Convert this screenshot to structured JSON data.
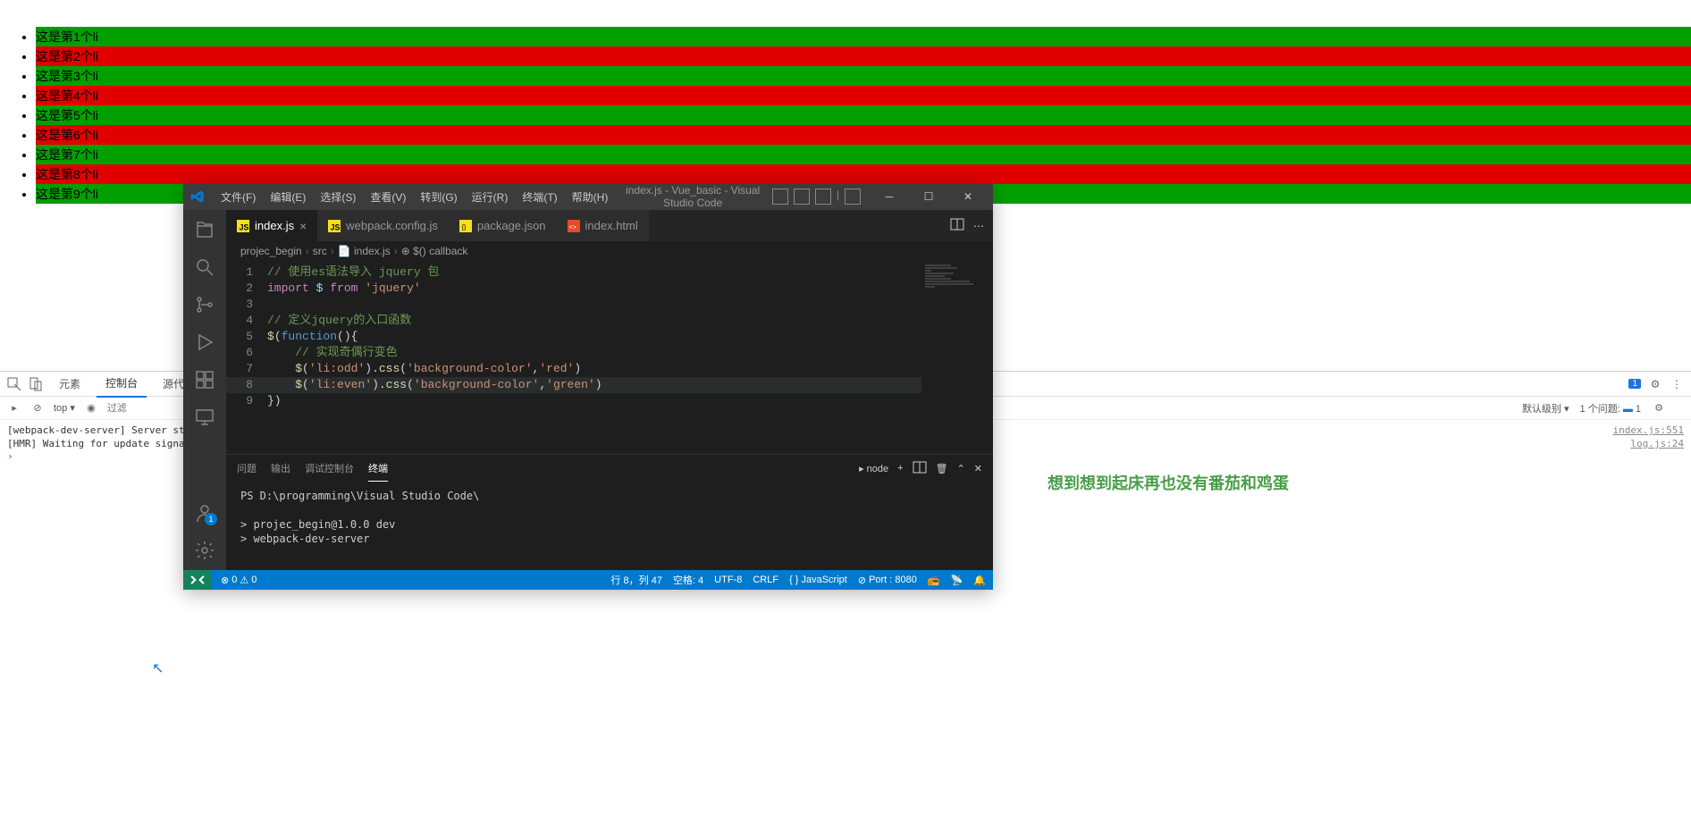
{
  "page": {
    "list_items": [
      "这是第1个li",
      "这是第2个li",
      "这是第3个li",
      "这是第4个li",
      "这是第5个li",
      "这是第6个li",
      "这是第7个li",
      "这是第8个li",
      "这是第9个li"
    ]
  },
  "devtools": {
    "tabs": {
      "elements": "元素",
      "console": "控制台",
      "sources": "源代码"
    },
    "toolbar": {
      "top": "top",
      "filter_placeholder": "过滤",
      "level": "默认级别",
      "issues_label": "1 个问题:",
      "issues_count": "1"
    },
    "console": [
      {
        "text": "[webpack-dev-server] Server started",
        "src": "index.js:551"
      },
      {
        "text": "[HMR] Waiting for update signal fr",
        "src": "log.js:24"
      }
    ],
    "errors_count": "1"
  },
  "vscode": {
    "menu": [
      "文件(F)",
      "编辑(E)",
      "选择(S)",
      "查看(V)",
      "转到(G)",
      "运行(R)",
      "终端(T)",
      "帮助(H)"
    ],
    "title": "index.js - Vue_basic - Visual Studio Code",
    "tabs": [
      {
        "icon": "js-icon",
        "label": "index.js",
        "active": true
      },
      {
        "icon": "js-icon",
        "label": "webpack.config.js",
        "active": false
      },
      {
        "icon": "json-icon",
        "label": "package.json",
        "active": false
      },
      {
        "icon": "html-icon",
        "label": "index.html",
        "active": false
      }
    ],
    "breadcrumb": [
      "projec_begin",
      "src",
      "index.js",
      "$() callback"
    ],
    "code_lines": [
      {
        "n": 1,
        "html": "<span class='tk-comment'>// 使用es语法导入 jquery 包</span>"
      },
      {
        "n": 2,
        "html": "<span class='tk-keyword'>import</span> <span class='tk-var'>$</span> <span class='tk-keyword'>from</span> <span class='tk-string'>'jquery'</span>"
      },
      {
        "n": 3,
        "html": ""
      },
      {
        "n": 4,
        "html": "<span class='tk-comment'>// 定义jquery的入口函数</span>"
      },
      {
        "n": 5,
        "html": "<span class='tk-func'>$</span><span class='tk-punc'>(</span><span class='tk-blue'>function</span><span class='tk-punc'>(){</span>"
      },
      {
        "n": 6,
        "html": "    <span class='tk-comment'>// 实现奇偶行变色</span>"
      },
      {
        "n": 7,
        "html": "    <span class='tk-func'>$</span><span class='tk-punc'>(</span><span class='tk-string'>'li:odd'</span><span class='tk-punc'>).</span><span class='tk-func'>css</span><span class='tk-punc'>(</span><span class='tk-string'>'background-color'</span><span class='tk-punc'>,</span><span class='tk-string'>'red'</span><span class='tk-punc'>)</span>"
      },
      {
        "n": 8,
        "html": "    <span class='tk-func'>$</span><span class='tk-punc'>(</span><span class='tk-string'>'li:even'</span><span class='tk-punc'>).</span><span class='tk-func'>css</span><span class='tk-punc'>(</span><span class='tk-string'>'background-color'</span><span class='tk-punc'>,</span><span class='tk-string'>'green'</span><span class='tk-punc'>)</span>",
        "current": true
      },
      {
        "n": 9,
        "html": "<span class='tk-punc'>})</span>"
      }
    ],
    "panel": {
      "tabs": [
        "问题",
        "输出",
        "调试控制台",
        "终端"
      ],
      "active_tab": 3,
      "terminal_select": "node",
      "terminal_lines": [
        "PS D:\\programming\\Visual Studio Code\\",
        "",
        "> projec_begin@1.0.0 dev",
        "> webpack-dev-server"
      ]
    },
    "statusbar": {
      "errors": "0",
      "warnings": "0",
      "position": "行 8，列 47",
      "spaces": "空格: 4",
      "encoding": "UTF-8",
      "eol": "CRLF",
      "lang": "JavaScript",
      "port": "Port : 8080"
    },
    "account_badge": "1"
  },
  "watermark": "想到想到起床再也没有番茄和鸡蛋"
}
